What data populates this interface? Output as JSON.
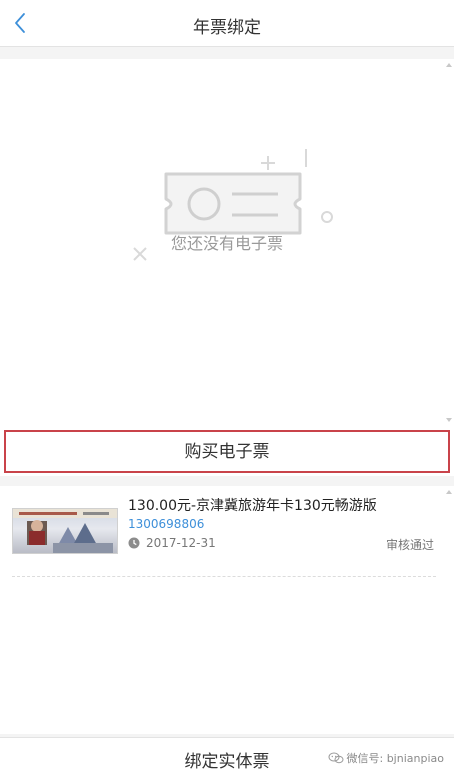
{
  "header": {
    "title": "年票绑定",
    "back_icon": "chevron-left-icon"
  },
  "empty_state": {
    "message": "您还没有电子票",
    "illustration_icon": "ticket-icon"
  },
  "buy_button": {
    "label": "购买电子票",
    "highlight_color": "#c9434a"
  },
  "cards": [
    {
      "title": "130.00元-京津冀旅游年卡130元畅游版",
      "phone": "1300698806",
      "date": "2017-12-31",
      "status": "审核通过"
    }
  ],
  "bottom_bar": {
    "bind_label": "绑定实体票"
  },
  "watermark": {
    "text": "微信号: bjnianpiao",
    "icon": "wechat-icon"
  },
  "colors": {
    "link_blue": "#3d8fd9",
    "accent_red": "#c9434a"
  }
}
